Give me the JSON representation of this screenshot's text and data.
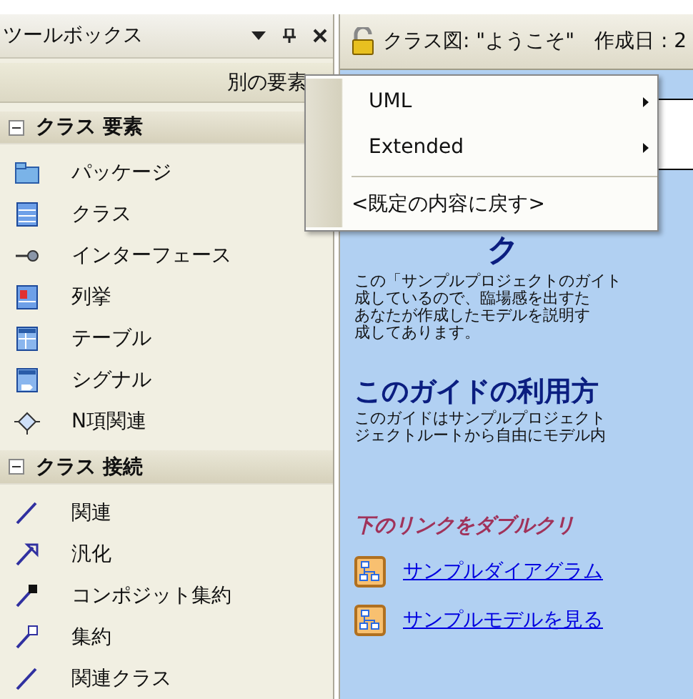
{
  "toolbox": {
    "title": "ツールボックス",
    "more_label": "別の要素",
    "sections": [
      {
        "title": "クラス 要素",
        "expanded": true,
        "items": [
          {
            "label": "パッケージ",
            "kind": "package"
          },
          {
            "label": "クラス",
            "kind": "class"
          },
          {
            "label": "インターフェース",
            "kind": "interface"
          },
          {
            "label": "列挙",
            "kind": "enum"
          },
          {
            "label": "テーブル",
            "kind": "table"
          },
          {
            "label": "シグナル",
            "kind": "signal"
          },
          {
            "label": "N項関連",
            "kind": "nary"
          }
        ]
      },
      {
        "title": "クラス 接続",
        "expanded": true,
        "items": [
          {
            "label": "関連",
            "kind": "association"
          },
          {
            "label": "汎化",
            "kind": "generalization"
          },
          {
            "label": "コンポジット集約",
            "kind": "composition"
          },
          {
            "label": "集約",
            "kind": "aggregation"
          },
          {
            "label": "関連クラス",
            "kind": "association"
          }
        ]
      }
    ]
  },
  "diagram": {
    "title": "クラス図: \"ようこそ\"",
    "created": "作成日 : 2",
    "heading_1": "ク",
    "paragraph_1": [
      "この「サンプルプロジェクトのガイト",
      "成しているので、臨場感を出すた",
      "あなたが作成したモデルを説明す",
      "成してあります。"
    ],
    "heading_2": "このガイドの利用方",
    "paragraph_2": [
      "このガイドはサンプルプロジェクト",
      "ジェクトルートから自由にモデル内"
    ],
    "instruction": "下のリンクをダブルクリ",
    "links": [
      "サンプルダイアグラム",
      "サンプルモデルを見る"
    ]
  },
  "context_menu": [
    {
      "kind": "submenu",
      "label": "UML"
    },
    {
      "kind": "submenu",
      "label": "Extended"
    },
    {
      "kind": "separator"
    },
    {
      "kind": "item",
      "label": "<既定の内容に戻す>"
    }
  ]
}
